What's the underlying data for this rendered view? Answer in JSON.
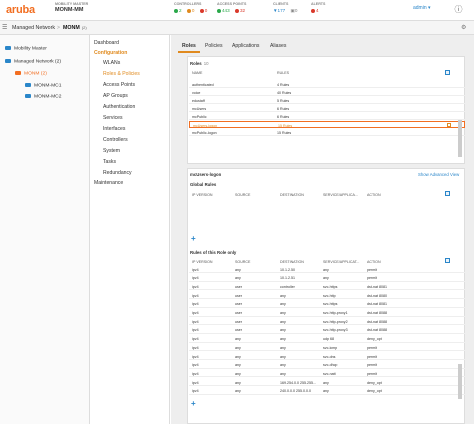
{
  "topbar": {
    "logo": "aruba",
    "mm_label": "MOBILITY MASTER",
    "mm_name": "MONM-MM",
    "controllers": {
      "label": "CONTROLLERS",
      "ok": "2",
      "warn": "0",
      "crit": "0"
    },
    "access_points": {
      "label": "ACCESS POINTS",
      "ok": "443",
      "crit": "32"
    },
    "clients": {
      "label": "CLIENTS",
      "wifi": "177",
      "wired": "0"
    },
    "alerts": {
      "label": "ALERTS",
      "crit": "4"
    },
    "user": "admin ▾"
  },
  "subbar": {
    "managed_network": "Managed Network",
    "device": "MONM",
    "device_suffix": "(2)"
  },
  "tree": {
    "items": [
      "Mobility Master",
      "Managed Network (2)",
      "MONM (2)",
      "MONM-MC1",
      "MONM-MC2"
    ]
  },
  "menu": {
    "dashboard": "Dashboard",
    "configuration": "Configuration",
    "items": [
      "WLANs",
      "Roles & Policies",
      "Access Points",
      "AP Groups",
      "Authentication",
      "Services",
      "Interfaces",
      "Controllers",
      "System",
      "Tasks",
      "Redundancy"
    ],
    "maintenance": "Maintenance"
  },
  "tabs": [
    "Roles",
    "Policies",
    "Applications",
    "Aliases"
  ],
  "roles": {
    "title": "Roles",
    "count": "10",
    "col_name": "NAME",
    "col_rules": "RULES",
    "rows": [
      {
        "name": "authenticated",
        "rules": "4 Rules"
      },
      {
        "name": "voice",
        "rules": "40 Rules"
      },
      {
        "name": "edustaff",
        "rules": "5 Rules"
      },
      {
        "name": "mcUsers",
        "rules": "6 Rules"
      },
      {
        "name": "mcPublic",
        "rules": "6 Rules"
      },
      {
        "name": "mcUsers-logon",
        "rules": "15 Rules"
      },
      {
        "name": "mcPublic-logon",
        "rules": "15 Rules"
      }
    ]
  },
  "detail": {
    "title": "mcUsers-logon",
    "advanced": "Show Advanced View",
    "global_title": "Global Rules",
    "global_cols": [
      "IP VERSION",
      "SOURCE",
      "DESTINATION",
      "SERVICE/APPLICA...",
      "ACTION"
    ],
    "role_title": "Rules of this Role only",
    "role_cols": [
      "IP VERSION",
      "SOURCE",
      "DESTINATION",
      "SERVICE/APPLICAT...",
      "ACTION"
    ],
    "rules": [
      [
        "ipv4",
        "any",
        "10.1.2.50",
        "any",
        "permit"
      ],
      [
        "ipv4",
        "any",
        "10.1.2.51",
        "any",
        "permit"
      ],
      [
        "ipv4",
        "user",
        "controller",
        "svc-https",
        "dst-nat 8081"
      ],
      [
        "ipv4",
        "user",
        "any",
        "svc-http",
        "dst-nat 8080"
      ],
      [
        "ipv4",
        "user",
        "any",
        "svc-https",
        "dst-nat 8081"
      ],
      [
        "ipv4",
        "user",
        "any",
        "svc-http-proxy1",
        "dst-nat 8088"
      ],
      [
        "ipv4",
        "user",
        "any",
        "svc-http-proxy2",
        "dst-nat 8088"
      ],
      [
        "ipv4",
        "user",
        "any",
        "svc-http-proxy3",
        "dst-nat 8088"
      ],
      [
        "ipv4",
        "any",
        "any",
        "udp 68",
        "deny_opt"
      ],
      [
        "ipv4",
        "any",
        "any",
        "svc-icmp",
        "permit"
      ],
      [
        "ipv4",
        "any",
        "any",
        "svc-dns",
        "permit"
      ],
      [
        "ipv4",
        "any",
        "any",
        "svc-dhcp",
        "permit"
      ],
      [
        "ipv4",
        "any",
        "any",
        "svc-natt",
        "permit"
      ],
      [
        "ipv4",
        "any",
        "169.254.0.0 255.255...",
        "any",
        "deny_opt"
      ],
      [
        "ipv4",
        "any",
        "240.0.0.0 255.0.0.0",
        "any",
        "deny_opt"
      ]
    ]
  },
  "colors": {
    "accent": "#f26e21",
    "link": "#2a86c9",
    "ok": "#2aa84a"
  }
}
